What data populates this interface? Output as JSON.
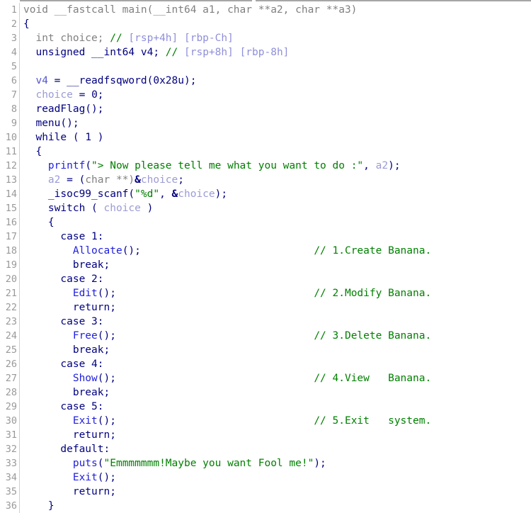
{
  "view": {
    "name": "decompiler-pseudocode",
    "background": "#ffffff",
    "gutter_color": "#999999",
    "colors": {
      "keyword": "#000080",
      "type": "#808080",
      "function": "#2020e0",
      "variable": "#9b9bd6",
      "string": "#008000",
      "comment": "#008000",
      "comment_dim": "#8f8fd9",
      "number": "#000080"
    }
  },
  "code": {
    "lines": [
      {
        "n": "1",
        "tokens": [
          {
            "t": "void __fastcall main(__int64 a1, char **a2, char **a3)",
            "c": "tok-decl"
          }
        ]
      },
      {
        "n": "2",
        "tokens": [
          {
            "t": "{",
            "c": "tok-kw"
          }
        ]
      },
      {
        "n": "3",
        "tokens": [
          {
            "t": "  int choice; ",
            "c": "tok-decl"
          },
          {
            "t": "// ",
            "c": "tok-cmt"
          },
          {
            "t": "[rsp+4h] [rbp-Ch]",
            "c": "tok-cmtdim"
          }
        ]
      },
      {
        "n": "4",
        "tokens": [
          {
            "t": "  unsigned __int64 v4; ",
            "c": "tok-kw"
          },
          {
            "t": "// ",
            "c": "tok-cmt"
          },
          {
            "t": "[rsp+8h] [rbp-8h]",
            "c": "tok-cmtdim"
          }
        ]
      },
      {
        "n": "5",
        "tokens": [
          {
            "t": "",
            "c": "tok-kw"
          }
        ]
      },
      {
        "n": "6",
        "tokens": [
          {
            "t": "  ",
            "c": "tok-kw"
          },
          {
            "t": "v4",
            "c": "tok-varblue"
          },
          {
            "t": " = __readfsqword(",
            "c": "tok-kw"
          },
          {
            "t": "0x28u",
            "c": "tok-num"
          },
          {
            "t": ");",
            "c": "tok-kw"
          }
        ]
      },
      {
        "n": "7",
        "tokens": [
          {
            "t": "  ",
            "c": "tok-kw"
          },
          {
            "t": "choice",
            "c": "tok-var"
          },
          {
            "t": " = ",
            "c": "tok-kw"
          },
          {
            "t": "0",
            "c": "tok-num"
          },
          {
            "t": ";",
            "c": "tok-kw"
          }
        ]
      },
      {
        "n": "8",
        "tokens": [
          {
            "t": "  readFlag();",
            "c": "tok-kw"
          }
        ]
      },
      {
        "n": "9",
        "tokens": [
          {
            "t": "  menu();",
            "c": "tok-kw"
          }
        ]
      },
      {
        "n": "10",
        "tokens": [
          {
            "t": "  while ( ",
            "c": "tok-kw"
          },
          {
            "t": "1",
            "c": "tok-num"
          },
          {
            "t": " )",
            "c": "tok-kw"
          }
        ]
      },
      {
        "n": "11",
        "tokens": [
          {
            "t": "  {",
            "c": "tok-kw"
          }
        ]
      },
      {
        "n": "12",
        "tokens": [
          {
            "t": "    ",
            "c": "tok-kw"
          },
          {
            "t": "printf",
            "c": "tok-fn"
          },
          {
            "t": "(",
            "c": "tok-kw"
          },
          {
            "t": "\"> Now please tell me what you want to do :\"",
            "c": "tok-str"
          },
          {
            "t": ", ",
            "c": "tok-kw"
          },
          {
            "t": "a2",
            "c": "tok-var"
          },
          {
            "t": ");",
            "c": "tok-kw"
          }
        ]
      },
      {
        "n": "13",
        "tokens": [
          {
            "t": "    ",
            "c": "tok-kw"
          },
          {
            "t": "a2",
            "c": "tok-var"
          },
          {
            "t": " = (",
            "c": "tok-kw"
          },
          {
            "t": "char",
            "c": "tok-type"
          },
          {
            "t": " **)",
            "c": "tok-type"
          },
          {
            "t": "&",
            "c": "tok-amp"
          },
          {
            "t": "choice",
            "c": "tok-var"
          },
          {
            "t": ";",
            "c": "tok-kw"
          }
        ]
      },
      {
        "n": "14",
        "tokens": [
          {
            "t": "    _isoc99_scanf(",
            "c": "tok-kw"
          },
          {
            "t": "\"%d\"",
            "c": "tok-str"
          },
          {
            "t": ", ",
            "c": "tok-kw"
          },
          {
            "t": "&",
            "c": "tok-amp"
          },
          {
            "t": "choice",
            "c": "tok-var"
          },
          {
            "t": ");",
            "c": "tok-kw"
          }
        ]
      },
      {
        "n": "15",
        "tokens": [
          {
            "t": "    switch ( ",
            "c": "tok-kw"
          },
          {
            "t": "choice",
            "c": "tok-var"
          },
          {
            "t": " )",
            "c": "tok-kw"
          }
        ]
      },
      {
        "n": "16",
        "tokens": [
          {
            "t": "    {",
            "c": "tok-kw"
          }
        ]
      },
      {
        "n": "17",
        "tokens": [
          {
            "t": "      case ",
            "c": "tok-kw"
          },
          {
            "t": "1",
            "c": "tok-num"
          },
          {
            "t": ":",
            "c": "tok-kw"
          }
        ]
      },
      {
        "n": "18",
        "tokens": [
          {
            "t": "        ",
            "c": "tok-kw"
          },
          {
            "t": "Allocate",
            "c": "tok-fn"
          },
          {
            "t": "();",
            "c": "tok-kw"
          },
          {
            "t": "                            ",
            "c": "tok-kw"
          },
          {
            "t": "// 1.Create Banana.",
            "c": "tok-cmt"
          }
        ]
      },
      {
        "n": "19",
        "tokens": [
          {
            "t": "        break;",
            "c": "tok-kw"
          }
        ]
      },
      {
        "n": "20",
        "tokens": [
          {
            "t": "      case ",
            "c": "tok-kw"
          },
          {
            "t": "2",
            "c": "tok-num"
          },
          {
            "t": ":",
            "c": "tok-kw"
          }
        ]
      },
      {
        "n": "21",
        "tokens": [
          {
            "t": "        ",
            "c": "tok-kw"
          },
          {
            "t": "Edit",
            "c": "tok-fn"
          },
          {
            "t": "();",
            "c": "tok-kw"
          },
          {
            "t": "                                ",
            "c": "tok-kw"
          },
          {
            "t": "// 2.Modify Banana.",
            "c": "tok-cmt"
          }
        ]
      },
      {
        "n": "22",
        "tokens": [
          {
            "t": "        return;",
            "c": "tok-kw"
          }
        ]
      },
      {
        "n": "23",
        "tokens": [
          {
            "t": "      case ",
            "c": "tok-kw"
          },
          {
            "t": "3",
            "c": "tok-num"
          },
          {
            "t": ":",
            "c": "tok-kw"
          }
        ]
      },
      {
        "n": "24",
        "tokens": [
          {
            "t": "        ",
            "c": "tok-kw"
          },
          {
            "t": "Free",
            "c": "tok-fn"
          },
          {
            "t": "();",
            "c": "tok-kw"
          },
          {
            "t": "                                ",
            "c": "tok-kw"
          },
          {
            "t": "// 3.Delete Banana.",
            "c": "tok-cmt"
          }
        ]
      },
      {
        "n": "25",
        "tokens": [
          {
            "t": "        break;",
            "c": "tok-kw"
          }
        ]
      },
      {
        "n": "26",
        "tokens": [
          {
            "t": "      case ",
            "c": "tok-kw"
          },
          {
            "t": "4",
            "c": "tok-num"
          },
          {
            "t": ":",
            "c": "tok-kw"
          }
        ]
      },
      {
        "n": "27",
        "tokens": [
          {
            "t": "        ",
            "c": "tok-kw"
          },
          {
            "t": "Show",
            "c": "tok-fn"
          },
          {
            "t": "();",
            "c": "tok-kw"
          },
          {
            "t": "                                ",
            "c": "tok-kw"
          },
          {
            "t": "// 4.View   Banana.",
            "c": "tok-cmt"
          }
        ]
      },
      {
        "n": "28",
        "tokens": [
          {
            "t": "        break;",
            "c": "tok-kw"
          }
        ]
      },
      {
        "n": "29",
        "tokens": [
          {
            "t": "      case ",
            "c": "tok-kw"
          },
          {
            "t": "5",
            "c": "tok-num"
          },
          {
            "t": ":",
            "c": "tok-kw"
          }
        ]
      },
      {
        "n": "30",
        "tokens": [
          {
            "t": "        ",
            "c": "tok-kw"
          },
          {
            "t": "Exit",
            "c": "tok-fn"
          },
          {
            "t": "();",
            "c": "tok-kw"
          },
          {
            "t": "                                ",
            "c": "tok-kw"
          },
          {
            "t": "// 5.Exit   system.",
            "c": "tok-cmt"
          }
        ]
      },
      {
        "n": "31",
        "tokens": [
          {
            "t": "        return;",
            "c": "tok-kw"
          }
        ]
      },
      {
        "n": "32",
        "tokens": [
          {
            "t": "      default:",
            "c": "tok-kw"
          }
        ]
      },
      {
        "n": "33",
        "tokens": [
          {
            "t": "        ",
            "c": "tok-kw"
          },
          {
            "t": "puts",
            "c": "tok-fn"
          },
          {
            "t": "(",
            "c": "tok-kw"
          },
          {
            "t": "\"Emmmmmmm!Maybe you want Fool me!\"",
            "c": "tok-str"
          },
          {
            "t": ");",
            "c": "tok-kw"
          }
        ]
      },
      {
        "n": "34",
        "tokens": [
          {
            "t": "        ",
            "c": "tok-kw"
          },
          {
            "t": "Exit",
            "c": "tok-fn"
          },
          {
            "t": "();",
            "c": "tok-kw"
          }
        ]
      },
      {
        "n": "35",
        "tokens": [
          {
            "t": "        return;",
            "c": "tok-kw"
          }
        ]
      },
      {
        "n": "36",
        "tokens": [
          {
            "t": "    }",
            "c": "tok-kw"
          }
        ]
      }
    ]
  }
}
